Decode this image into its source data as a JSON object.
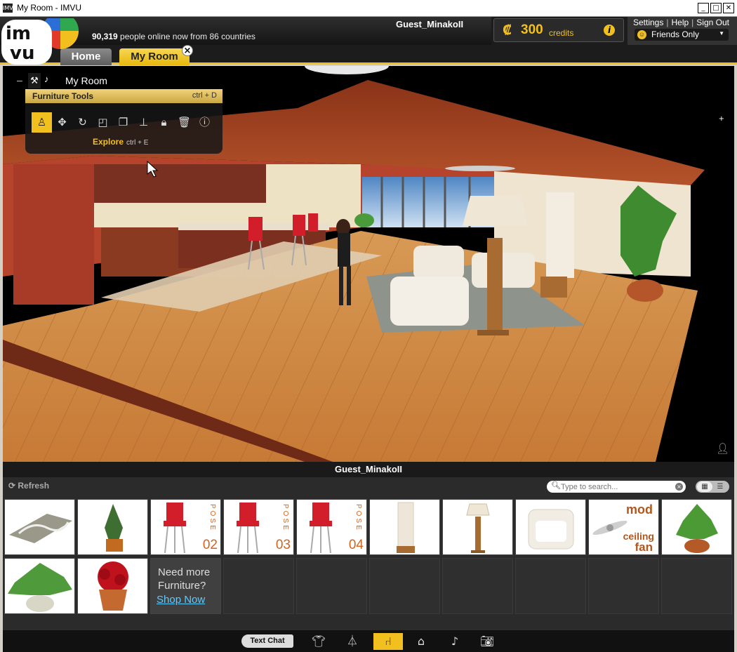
{
  "window": {
    "title": "My Room - IMVU",
    "app_icon": "IMVU"
  },
  "header": {
    "online_count": "90,319",
    "online_text": "people online now from 86 countries",
    "username": "Guest_MinakoII",
    "credits": {
      "symbol": "₡",
      "amount": "300",
      "label": "credits"
    },
    "links": {
      "settings": "Settings",
      "help": "Help",
      "signout": "Sign Out"
    },
    "status": "Friends Only"
  },
  "tabs": {
    "home": "Home",
    "my_room": "My Room"
  },
  "room": {
    "title": "My Room",
    "tools": {
      "header": "Furniture Tools",
      "shortcut": "ctrl + D",
      "explore": "Explore",
      "explore_shortcut": "ctrl + E"
    },
    "nameplate": "Guest_MinakoII"
  },
  "inventory": {
    "refresh": "Refresh",
    "search_placeholder": "Type to search...",
    "pose_word": "POSE",
    "items": [
      {
        "name": "rug",
        "icon": "rug-icon"
      },
      {
        "name": "potted tree",
        "icon": "plant-icon"
      },
      {
        "name": "stool",
        "pose": "02",
        "icon": "stool-icon"
      },
      {
        "name": "stool",
        "pose": "03",
        "icon": "stool-icon"
      },
      {
        "name": "stool",
        "pose": "04",
        "icon": "stool-icon"
      },
      {
        "name": "floor lamp",
        "icon": "lamp-icon"
      },
      {
        "name": "table lamp",
        "icon": "lamp-icon"
      },
      {
        "name": "armchair",
        "icon": "chair-icon"
      },
      {
        "name": "ceiling fan",
        "brand": "mod",
        "label1": "ceiling",
        "label2": "fan",
        "icon": "fan-icon"
      },
      {
        "name": "potted plant",
        "icon": "plant-icon"
      },
      {
        "name": "plant",
        "icon": "plant-icon"
      },
      {
        "name": "roses",
        "icon": "flower-icon"
      }
    ],
    "need_more_1": "Need more",
    "need_more_2": "Furniture?",
    "shop_now": "Shop Now"
  },
  "bottombar": {
    "text_chat": "Text Chat"
  }
}
